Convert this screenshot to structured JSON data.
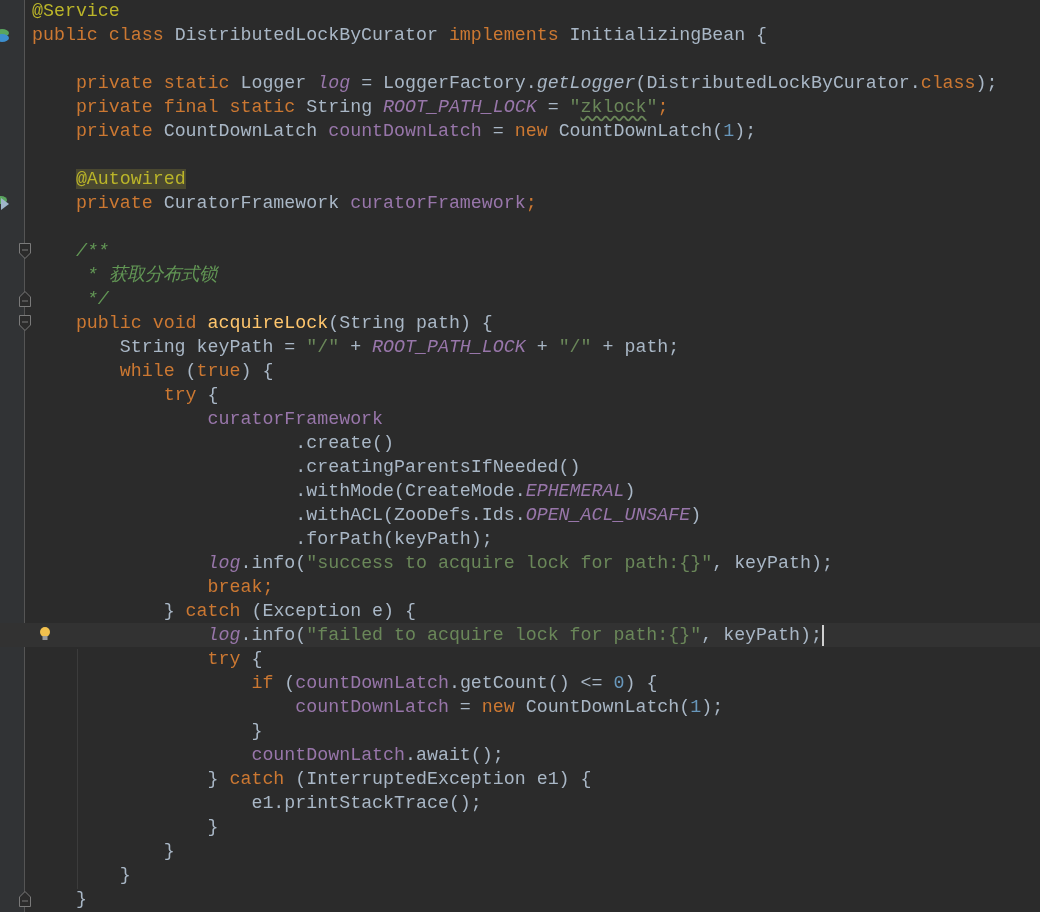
{
  "editor": {
    "lines": [
      {
        "current": false,
        "tokens": [
          {
            "text": "@Service",
            "kind": "annotation"
          }
        ]
      },
      {
        "current": false,
        "tokens": [
          {
            "text": "public class ",
            "kind": "keyword"
          },
          {
            "text": "DistributedLockByCurator ",
            "kind": "plain"
          },
          {
            "text": "implements ",
            "kind": "keyword"
          },
          {
            "text": "InitializingBean {",
            "kind": "plain"
          }
        ]
      },
      {
        "current": false
      },
      {
        "current": false,
        "tokens": [
          {
            "text": "    private static ",
            "kind": "keyword"
          },
          {
            "text": "Logger ",
            "kind": "plain"
          },
          {
            "text": "log",
            "kind": "static-field"
          },
          {
            "text": " = LoggerFactory.",
            "kind": "plain"
          },
          {
            "text": "getLogger",
            "kind": "static-call"
          },
          {
            "text": "(DistributedLockByCurator.",
            "kind": "plain"
          },
          {
            "text": "class",
            "kind": "keyword"
          },
          {
            "text": ");",
            "kind": "plain"
          }
        ]
      },
      {
        "current": false,
        "tokens": [
          {
            "text": "    private final static ",
            "kind": "keyword"
          },
          {
            "text": "String ",
            "kind": "plain"
          },
          {
            "text": "ROOT_PATH_LOCK",
            "kind": "static-field"
          },
          {
            "text": " = ",
            "kind": "plain"
          },
          {
            "text": "\"",
            "kind": "string"
          },
          {
            "text": "zklock",
            "kind": "string-typo"
          },
          {
            "text": "\"",
            "kind": "string"
          },
          {
            "text": ";",
            "kind": "keyword"
          }
        ]
      },
      {
        "current": false,
        "tokens": [
          {
            "text": "    private ",
            "kind": "keyword"
          },
          {
            "text": "CountDownLatch ",
            "kind": "plain"
          },
          {
            "text": "countDownLatch",
            "kind": "field"
          },
          {
            "text": " = ",
            "kind": "plain"
          },
          {
            "text": "new ",
            "kind": "keyword"
          },
          {
            "text": "CountDownLatch(",
            "kind": "plain"
          },
          {
            "text": "1",
            "kind": "number"
          },
          {
            "text": ");",
            "kind": "plain"
          }
        ]
      },
      {
        "current": false
      },
      {
        "current": false,
        "tokens": [
          {
            "text": "    @Autowired",
            "kind": "annotation-marked"
          }
        ]
      },
      {
        "current": false,
        "tokens": [
          {
            "text": "    private ",
            "kind": "keyword"
          },
          {
            "text": "CuratorFramework ",
            "kind": "plain"
          },
          {
            "text": "curatorFramework",
            "kind": "field"
          },
          {
            "text": ";",
            "kind": "keyword"
          }
        ]
      },
      {
        "current": false
      },
      {
        "current": false,
        "tokens": [
          {
            "text": "    /**",
            "kind": "comment"
          }
        ]
      },
      {
        "current": false,
        "tokens": [
          {
            "text": "     * 获取分布式锁",
            "kind": "comment"
          }
        ]
      },
      {
        "current": false,
        "tokens": [
          {
            "text": "     */",
            "kind": "comment"
          }
        ]
      },
      {
        "current": false,
        "tokens": [
          {
            "text": "    public void ",
            "kind": "keyword"
          },
          {
            "text": "acquireLock",
            "kind": "method"
          },
          {
            "text": "(String path) {",
            "kind": "plain"
          }
        ]
      },
      {
        "current": false,
        "tokens": [
          {
            "text": "        String keyPath = ",
            "kind": "plain"
          },
          {
            "text": "\"/\"",
            "kind": "string"
          },
          {
            "text": " + ",
            "kind": "plain"
          },
          {
            "text": "ROOT_PATH_LOCK",
            "kind": "static-field"
          },
          {
            "text": " + ",
            "kind": "plain"
          },
          {
            "text": "\"/\"",
            "kind": "string"
          },
          {
            "text": " + path;",
            "kind": "plain"
          }
        ]
      },
      {
        "current": false,
        "tokens": [
          {
            "text": "        while ",
            "kind": "keyword"
          },
          {
            "text": "(",
            "kind": "plain"
          },
          {
            "text": "true",
            "kind": "keyword"
          },
          {
            "text": ") {",
            "kind": "plain"
          }
        ]
      },
      {
        "current": false,
        "tokens": [
          {
            "text": "            try ",
            "kind": "keyword"
          },
          {
            "text": "{",
            "kind": "plain"
          }
        ]
      },
      {
        "current": false,
        "tokens": [
          {
            "text": "                curatorFramework",
            "kind": "field"
          }
        ]
      },
      {
        "current": false,
        "tokens": [
          {
            "text": "                        .create()",
            "kind": "plain"
          }
        ]
      },
      {
        "current": false,
        "tokens": [
          {
            "text": "                        .creatingParentsIfNeeded()",
            "kind": "plain"
          }
        ]
      },
      {
        "current": false,
        "tokens": [
          {
            "text": "                        .withMode(CreateMode.",
            "kind": "plain"
          },
          {
            "text": "EPHEMERAL",
            "kind": "static-field"
          },
          {
            "text": ")",
            "kind": "plain"
          }
        ]
      },
      {
        "current": false,
        "tokens": [
          {
            "text": "                        .withACL(ZooDefs.Ids.",
            "kind": "plain"
          },
          {
            "text": "OPEN_ACL_UNSAFE",
            "kind": "static-field"
          },
          {
            "text": ")",
            "kind": "plain"
          }
        ]
      },
      {
        "current": false,
        "tokens": [
          {
            "text": "                        .forPath(keyPath);",
            "kind": "plain"
          }
        ]
      },
      {
        "current": false,
        "tokens": [
          {
            "text": "                log",
            "kind": "static-field"
          },
          {
            "text": ".info(",
            "kind": "plain"
          },
          {
            "text": "\"success to acquire lock for path:{}\"",
            "kind": "string"
          },
          {
            "text": ", keyPath);",
            "kind": "plain"
          }
        ]
      },
      {
        "current": false,
        "tokens": [
          {
            "text": "                break;",
            "kind": "keyword"
          }
        ]
      },
      {
        "current": false,
        "tokens": [
          {
            "text": "            } ",
            "kind": "plain"
          },
          {
            "text": "catch ",
            "kind": "keyword"
          },
          {
            "text": "(Exception e) {",
            "kind": "plain"
          }
        ]
      },
      {
        "current": true,
        "tokens": [
          {
            "text": "                log",
            "kind": "static-field"
          },
          {
            "text": ".info(",
            "kind": "plain"
          },
          {
            "text": "\"failed to acquire lock for path:{}\"",
            "kind": "string"
          },
          {
            "text": ", keyPath);",
            "kind": "plain"
          }
        ]
      },
      {
        "current": false,
        "tokens": [
          {
            "text": "                try ",
            "kind": "keyword"
          },
          {
            "text": "{",
            "kind": "plain"
          }
        ]
      },
      {
        "current": false,
        "tokens": [
          {
            "text": "                    if ",
            "kind": "keyword"
          },
          {
            "text": "(",
            "kind": "plain"
          },
          {
            "text": "countDownLatch",
            "kind": "field"
          },
          {
            "text": ".getCount() <= ",
            "kind": "plain"
          },
          {
            "text": "0",
            "kind": "number"
          },
          {
            "text": ") {",
            "kind": "plain"
          }
        ]
      },
      {
        "current": false,
        "tokens": [
          {
            "text": "                        countDownLatch",
            "kind": "field"
          },
          {
            "text": " = ",
            "kind": "plain"
          },
          {
            "text": "new ",
            "kind": "keyword"
          },
          {
            "text": "CountDownLatch(",
            "kind": "plain"
          },
          {
            "text": "1",
            "kind": "number"
          },
          {
            "text": ");",
            "kind": "plain"
          }
        ]
      },
      {
        "current": false,
        "tokens": [
          {
            "text": "                    }",
            "kind": "plain"
          }
        ]
      },
      {
        "current": false,
        "tokens": [
          {
            "text": "                    countDownLatch",
            "kind": "field"
          },
          {
            "text": ".await();",
            "kind": "plain"
          }
        ]
      },
      {
        "current": false,
        "tokens": [
          {
            "text": "                } ",
            "kind": "plain"
          },
          {
            "text": "catch ",
            "kind": "keyword"
          },
          {
            "text": "(InterruptedException e1) {",
            "kind": "plain"
          }
        ]
      },
      {
        "current": false,
        "tokens": [
          {
            "text": "                    e1.printStackTrace();",
            "kind": "plain"
          }
        ]
      },
      {
        "current": false,
        "tokens": [
          {
            "text": "                }",
            "kind": "plain"
          }
        ]
      },
      {
        "current": false,
        "tokens": [
          {
            "text": "            }",
            "kind": "plain"
          }
        ]
      },
      {
        "current": false,
        "tokens": [
          {
            "text": "        }",
            "kind": "plain"
          }
        ]
      },
      {
        "current": false,
        "tokens": [
          {
            "text": "    }",
            "kind": "plain"
          }
        ]
      }
    ]
  }
}
